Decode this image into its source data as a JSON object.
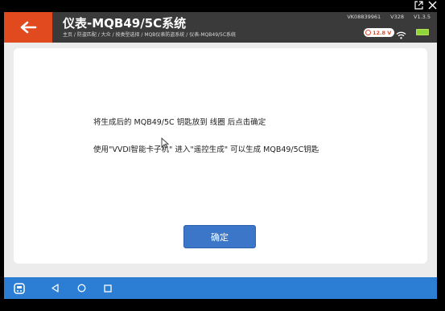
{
  "window": {
    "icons": [
      "external-link-icon",
      "close-icon"
    ]
  },
  "header": {
    "back_icon": "arrow-left-icon",
    "title": "仪表-MQB49/5C系统",
    "breadcrumb": "主页 / 防盗匹配 / 大众 / 按类型选择 / MQB仪表防盗系统 / 仪表-MQB49/5C系统",
    "device_id": "VK08839961",
    "version_v": "V328",
    "version_app": "V1.3.5",
    "voltage": "12.8 V",
    "colors": {
      "accent": "#e14a1e",
      "header_bg": "#3a3a3a",
      "battery": "#8fd63a"
    }
  },
  "content": {
    "message_line1": "将生成后的 MQB49/5C 钥匙放到 线圈 后点击确定",
    "message_line2": "使用\"VVDI智能卡子机\" 进入\"遥控生成\" 可以生成 MQB49/5C钥匙",
    "confirm_button": "确定",
    "colors": {
      "button": "#3b76c8"
    }
  },
  "navbar": {
    "icons": [
      "app-logo-icon",
      "back-triangle-icon",
      "home-circle-icon",
      "recents-square-icon"
    ],
    "colors": {
      "bg": "#2c7ed4"
    }
  }
}
